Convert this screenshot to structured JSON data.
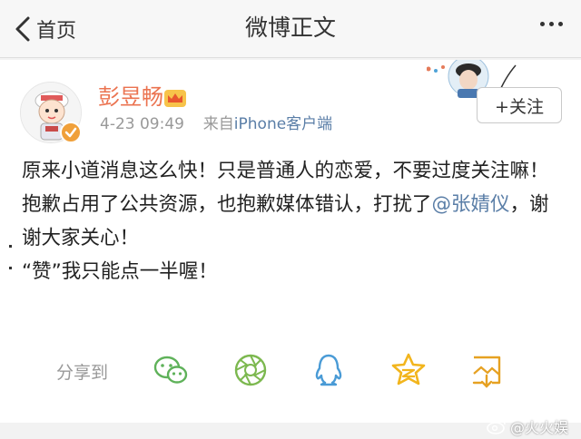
{
  "navbar": {
    "back_label": "首页",
    "title": "微博正文"
  },
  "post": {
    "username": "彭昱畅",
    "time": "4-23 09:49",
    "source_prefix": "来自",
    "source": "iPhone客户端",
    "follow_label": "+关注",
    "content": {
      "line1": "原来小道消息这么快！只是普通人的恋爱，不要过度关注嘛！",
      "line2_text": "抱歉占用了公共资源，也抱歉媒体错认，打扰了",
      "line2_mention": "@张婧仪",
      "line2_tail": "，谢谢大家关心！",
      "line3": "“赞”我只能点一半喔！"
    }
  },
  "share": {
    "label": "分享到",
    "targets": [
      "wechat-icon",
      "moments-icon",
      "qq-icon",
      "qzone-icon",
      "save-image-icon"
    ]
  },
  "watermark": {
    "text": "@火火娱"
  },
  "colors": {
    "username": "#eb7350",
    "link": "#5a7ea7",
    "icon_green": "#5fb25a",
    "icon_blue": "#4a9bd6",
    "icon_star": "#f2b51d"
  }
}
